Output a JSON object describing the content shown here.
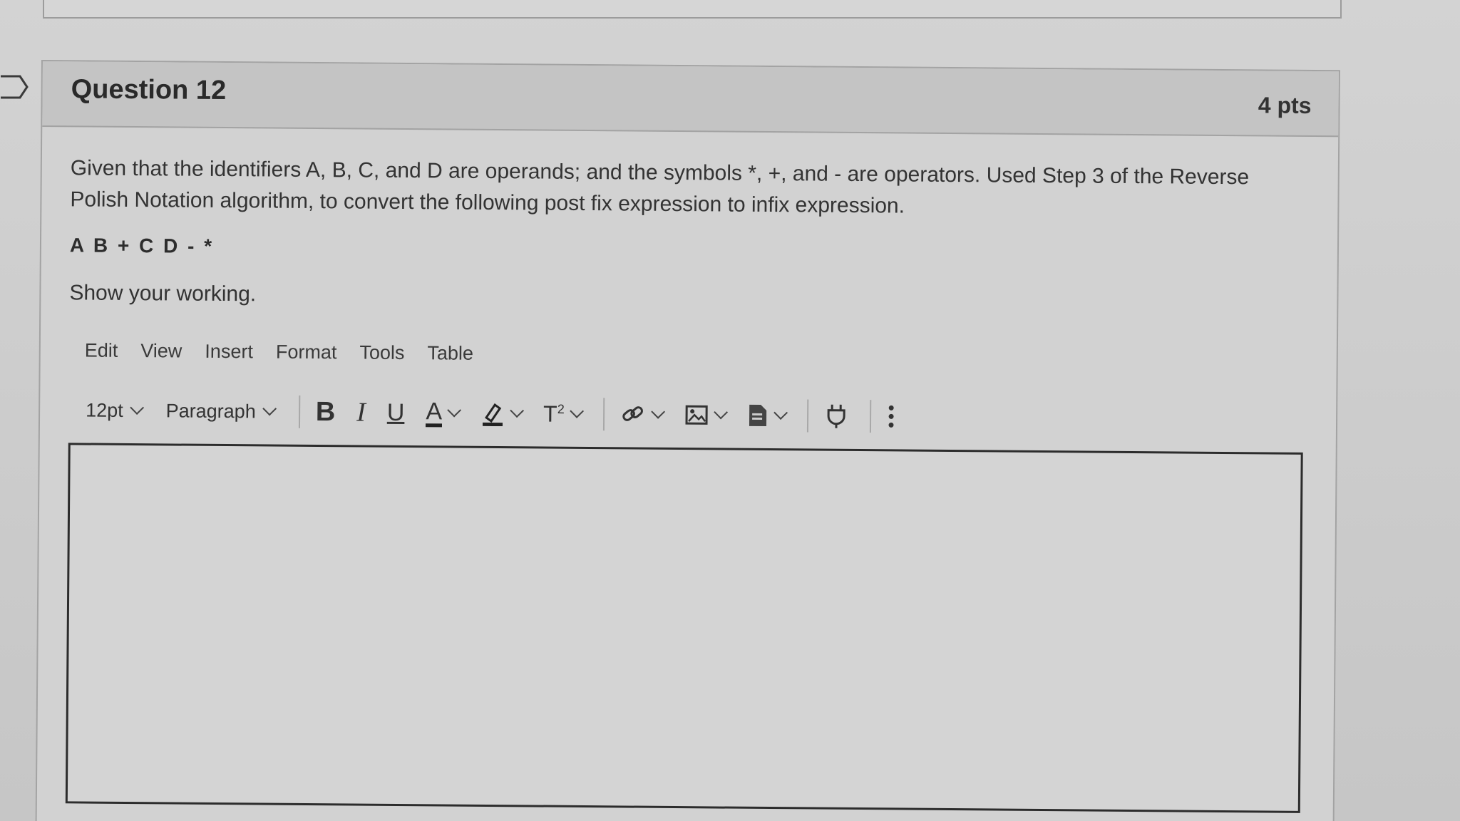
{
  "question": {
    "title": "Question 12",
    "points": "4 pts",
    "prompt": "Given that the identifiers A, B, C, and D are operands; and the symbols *, +, and - are operators. Used Step 3 of the Reverse Polish Notation algorithm, to convert the following post fix expression to infix expression.",
    "expression": "A B + C D - *",
    "instruction": "Show your working."
  },
  "editor": {
    "menu": [
      "Edit",
      "View",
      "Insert",
      "Format",
      "Tools",
      "Table"
    ],
    "font_size": "12pt",
    "block_format": "Paragraph",
    "bold_label": "B",
    "italic_label": "I",
    "underline_label": "U",
    "font_color_label": "A",
    "superscript_label": "T",
    "superscript_mark": "2",
    "body_value": ""
  },
  "icons": [
    "flag-icon",
    "bold-icon",
    "italic-icon",
    "underline-icon",
    "font-color-icon",
    "highlight-icon",
    "superscript-icon",
    "link-icon",
    "image-icon",
    "document-icon",
    "plugin-icon",
    "more-options-icon",
    "chevron-down-icon"
  ]
}
